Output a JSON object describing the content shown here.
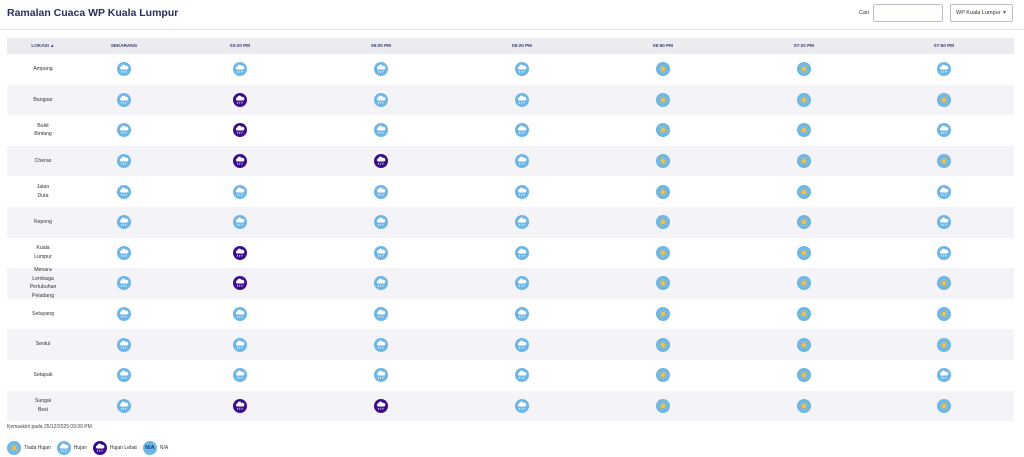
{
  "header": {
    "title": "Ramalan Cuaca WP Kuala Lumpur",
    "search_label": "Cari",
    "search_value": "",
    "region_select": "WP Kuala Lumpur"
  },
  "columns": [
    "LOKASI ▲",
    "SEKARANG",
    "03:20 PM",
    "05:00 PM",
    "06:20 PM",
    "06:50 PM",
    "07:20 PM",
    "07:50 PM"
  ],
  "rows": [
    {
      "location": "Ampang",
      "forecast": [
        "hujan",
        "hujan",
        "hujan",
        "hujan",
        "tiada",
        "tiada",
        "hujan"
      ]
    },
    {
      "location": "Bangsar",
      "forecast": [
        "hujan",
        "lebat",
        "hujan",
        "hujan",
        "tiada",
        "tiada",
        "tiada"
      ]
    },
    {
      "location": "Bukit Bintang",
      "forecast": [
        "hujan",
        "lebat",
        "hujan",
        "hujan",
        "tiada",
        "tiada",
        "hujan"
      ]
    },
    {
      "location": "Cheras",
      "forecast": [
        "hujan",
        "lebat",
        "lebat",
        "hujan",
        "tiada",
        "tiada",
        "tiada"
      ]
    },
    {
      "location": "Jalan Duta",
      "forecast": [
        "hujan",
        "hujan",
        "hujan",
        "hujan",
        "tiada",
        "tiada",
        "hujan"
      ]
    },
    {
      "location": "Kepong",
      "forecast": [
        "hujan",
        "hujan",
        "hujan",
        "hujan",
        "tiada",
        "tiada",
        "hujan"
      ]
    },
    {
      "location": "Kuala Lumpur",
      "forecast": [
        "hujan",
        "lebat",
        "hujan",
        "hujan",
        "tiada",
        "tiada",
        "hujan"
      ]
    },
    {
      "location": "Menara Lembaga Pertubuhan Peladang",
      "forecast": [
        "hujan",
        "lebat",
        "hujan",
        "hujan",
        "tiada",
        "tiada",
        "tiada"
      ]
    },
    {
      "location": "Setayang",
      "forecast": [
        "hujan",
        "hujan",
        "hujan",
        "hujan",
        "tiada",
        "tiada",
        "tiada"
      ]
    },
    {
      "location": "Sentul",
      "forecast": [
        "hujan",
        "hujan",
        "hujan",
        "hujan",
        "tiada",
        "tiada",
        "tiada"
      ]
    },
    {
      "location": "Setapak",
      "forecast": [
        "hujan",
        "hujan",
        "hujan",
        "hujan",
        "tiada",
        "tiada",
        "hujan"
      ]
    },
    {
      "location": "Sungai Besi",
      "forecast": [
        "hujan",
        "lebat",
        "lebat",
        "hujan",
        "tiada",
        "tiada",
        "tiada"
      ]
    }
  ],
  "updated_text": "Kemaskini pada 25/12/2025 03:00 PM",
  "legend": [
    {
      "key": "tiada",
      "label": "Tiada Hujan"
    },
    {
      "key": "hujan",
      "label": "Hujan"
    },
    {
      "key": "lebat",
      "label": "Hujan Lebat"
    },
    {
      "key": "na",
      "label": "N/A",
      "badge": "N/A"
    }
  ],
  "colors": {
    "title": "#2b2d5e",
    "icon_light": "#6db6e6",
    "icon_heavy": "#3b0d8c",
    "header_row": "#ebebf0",
    "alt_row": "#f4f4f8"
  },
  "icons": {
    "hujan": "rain-cloud-icon",
    "lebat": "heavy-rain-cloud-icon",
    "tiada": "sun-icon",
    "na": "na-badge-icon"
  }
}
